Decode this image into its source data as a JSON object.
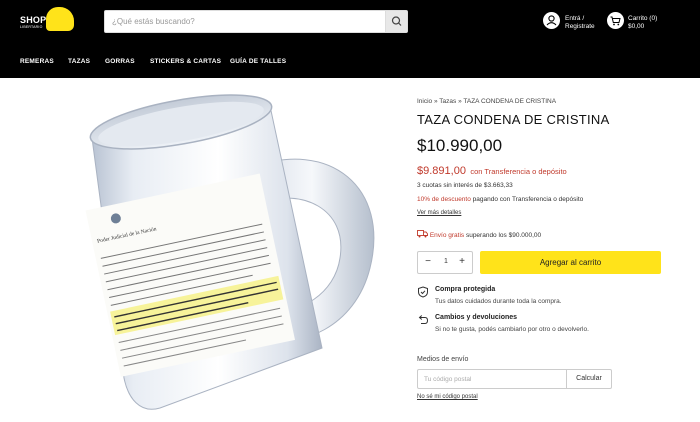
{
  "header": {
    "logo_text": "SHOP",
    "logo_sub": "LIBERTARIO",
    "search_placeholder": "¿Qué estás buscando?",
    "account_line1": "Entrá /",
    "account_line2": "Registrate",
    "cart_line1": "Carrito (0)",
    "cart_line2": "$0,00"
  },
  "nav": {
    "items": [
      {
        "label": "REMERAS"
      },
      {
        "label": "TAZAS"
      },
      {
        "label": "GORRAS"
      },
      {
        "label": "STICKERS & CARTAS"
      },
      {
        "label": "GUÍA DE TALLES"
      }
    ]
  },
  "product": {
    "breadcrumb": "Inicio » Tazas » TAZA CONDENA DE CRISTINA",
    "title": "TAZA CONDENA DE CRISTINA",
    "price": "$10.990,00",
    "transfer_price": "$9.891,00",
    "transfer_label": "con Transferencia o depósito",
    "installments": "3 cuotas sin interés de $3.663,33",
    "discount_pct": "10% de descuento",
    "discount_rest": "pagando con Transferencia o depósito",
    "details_link": "Ver más detalles",
    "shipping_free": "Envío gratis",
    "shipping_rest": "superando los $90.000,00",
    "quantity": "1",
    "add_to_cart": "Agregar al carrito"
  },
  "features": [
    {
      "icon": "shield-check-icon",
      "title": "Compra protegida",
      "desc": "Tus datos cuidados durante toda la compra."
    },
    {
      "icon": "return-arrow-icon",
      "title": "Cambios y devoluciones",
      "desc": "Si no te gusta, podés cambiarlo por otro o devolverlo."
    }
  ],
  "shipping_calc": {
    "label": "Medios de envío",
    "placeholder": "Tu código postal",
    "button": "Calcular",
    "no_cp_link": "No sé mi código postal"
  },
  "image": {
    "doc_header": "Poder Judicial de la Nación",
    "doc_highlight": "CONDENAR a CRISTINA ELISABET FERNÁNDEZ DE KIRCHNER a la PENA DE SEIS (6) AÑOS DE PRISIÓN"
  },
  "colors": {
    "header_bg": "#000000",
    "accent_yellow": "#ffe31a",
    "sale_red": "#c0392b"
  }
}
